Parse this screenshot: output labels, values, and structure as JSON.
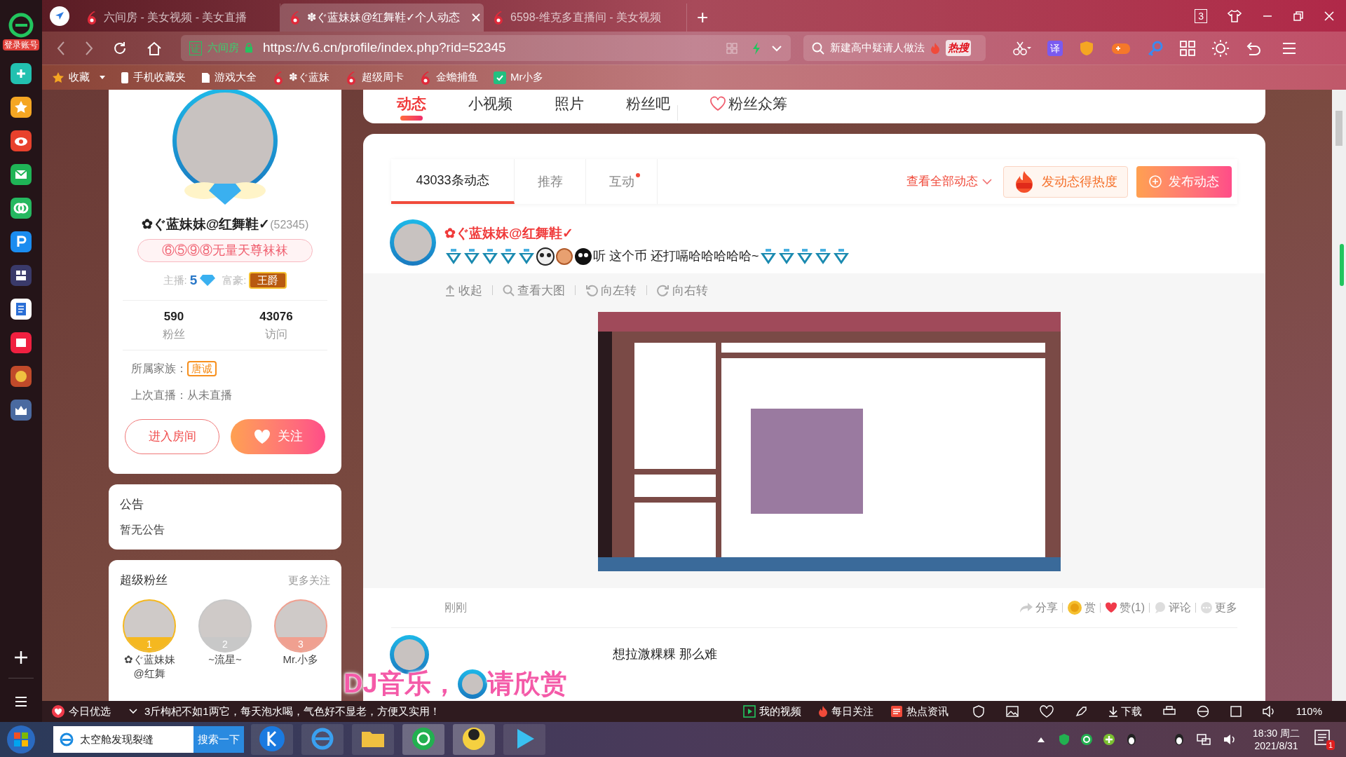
{
  "browser": {
    "login_label": "登录账号",
    "tabs": [
      {
        "title": "六间房 - 美女视频 - 美女直播",
        "selected": false
      },
      {
        "title": "✽ぐ蓝妹妹@红舞鞋✓个人动态",
        "selected": true
      },
      {
        "title": "6598-维克多直播间 - 美女视频",
        "selected": false
      }
    ],
    "new_tab": "+",
    "tab_count": "3",
    "cert_badge": "证",
    "cert_name": "六间房",
    "url": "https://v.6.cn/profile/index.php?rid=52345",
    "search_text": "新建高中疑请人做法",
    "search_hot": "热搜",
    "translate_label": "译",
    "bookmarks": [
      {
        "label": "收藏",
        "kind": "star"
      },
      {
        "label": "手机收藏夹",
        "kind": "phone"
      },
      {
        "label": "游戏大全",
        "kind": "page"
      },
      {
        "label": "✽ぐ蓝妹",
        "kind": "six"
      },
      {
        "label": "超级周卡",
        "kind": "six"
      },
      {
        "label": "金蟾捕鱼",
        "kind": "six"
      },
      {
        "label": "Mr小多",
        "kind": "app"
      }
    ]
  },
  "profile": {
    "name": "✿ぐ蓝妹妹@红舞鞋✓",
    "rid": "(52345)",
    "badge": "⑥⑤⑨⑧无量天尊袜袜",
    "host_label": "主播:",
    "host_level": "5",
    "rich_label": "富豪:",
    "rich_title": "王爵",
    "stats": [
      {
        "value": "590",
        "label": "粉丝"
      },
      {
        "value": "43076",
        "label": "访问"
      }
    ],
    "family_label": "所属家族：",
    "family": "唐诚",
    "last_live": "上次直播：从未直播",
    "enter_button": "进入房间",
    "follow_button": "关注"
  },
  "notice": {
    "title": "公告",
    "text": "暂无公告"
  },
  "super_fans": {
    "title": "超级粉丝",
    "more": "更多关注",
    "fans": [
      {
        "rank": "1",
        "name": "✿ぐ蓝妹妹@红舞"
      },
      {
        "rank": "2",
        "name": "~流星~"
      },
      {
        "rank": "3",
        "name": "Mr.小多"
      }
    ]
  },
  "nav_tabs": [
    {
      "label": "动态",
      "selected": true
    },
    {
      "label": "小视频",
      "selected": false
    },
    {
      "label": "照片",
      "selected": false
    },
    {
      "label": "粉丝吧",
      "selected": false
    },
    {
      "label": "粉丝众筹",
      "selected": false
    }
  ],
  "feed_tabs": [
    {
      "label": "43033条动态",
      "selected": true,
      "has_new": false
    },
    {
      "label": "推荐",
      "selected": false,
      "has_new": false
    },
    {
      "label": "互动",
      "selected": false,
      "has_new": true
    }
  ],
  "feed_actions": {
    "filter": "查看全部动态",
    "heat_button": "发动态得热度",
    "publish_button": "发布动态"
  },
  "posts": [
    {
      "author": "✿ぐ蓝妹妹@红舞鞋✓",
      "text": "听 这个币 还打嗝哈哈哈哈哈~",
      "image_tools": [
        "收起",
        "查看大图",
        "向左转",
        "向右转"
      ],
      "time": "刚刚",
      "actions": [
        {
          "label": "分享",
          "kind": "share"
        },
        {
          "label": "赏",
          "kind": "reward"
        },
        {
          "label": "赞(1)",
          "kind": "like"
        },
        {
          "label": "评论",
          "kind": "comment"
        },
        {
          "label": "更多",
          "kind": "more"
        }
      ]
    },
    {
      "text": "想拉溦粿粿 那么难"
    }
  ],
  "overlay": {
    "parts": [
      "DJ音乐，",
      "请欣赏"
    ]
  },
  "status_bar": {
    "today": "今日优选",
    "ticker": "3斤枸杞不如1两它，每天泡水喝，气色好不显老，方便又实用！",
    "items": [
      "我的视频",
      "每日关注",
      "热点资讯"
    ],
    "download": "下载",
    "zoom": "110%"
  },
  "taskbar": {
    "search_text": "太空舱发现裂缝",
    "search_button": "搜索一下",
    "time": "18:30 周二",
    "date": "2021/8/31",
    "notifications": "1"
  }
}
